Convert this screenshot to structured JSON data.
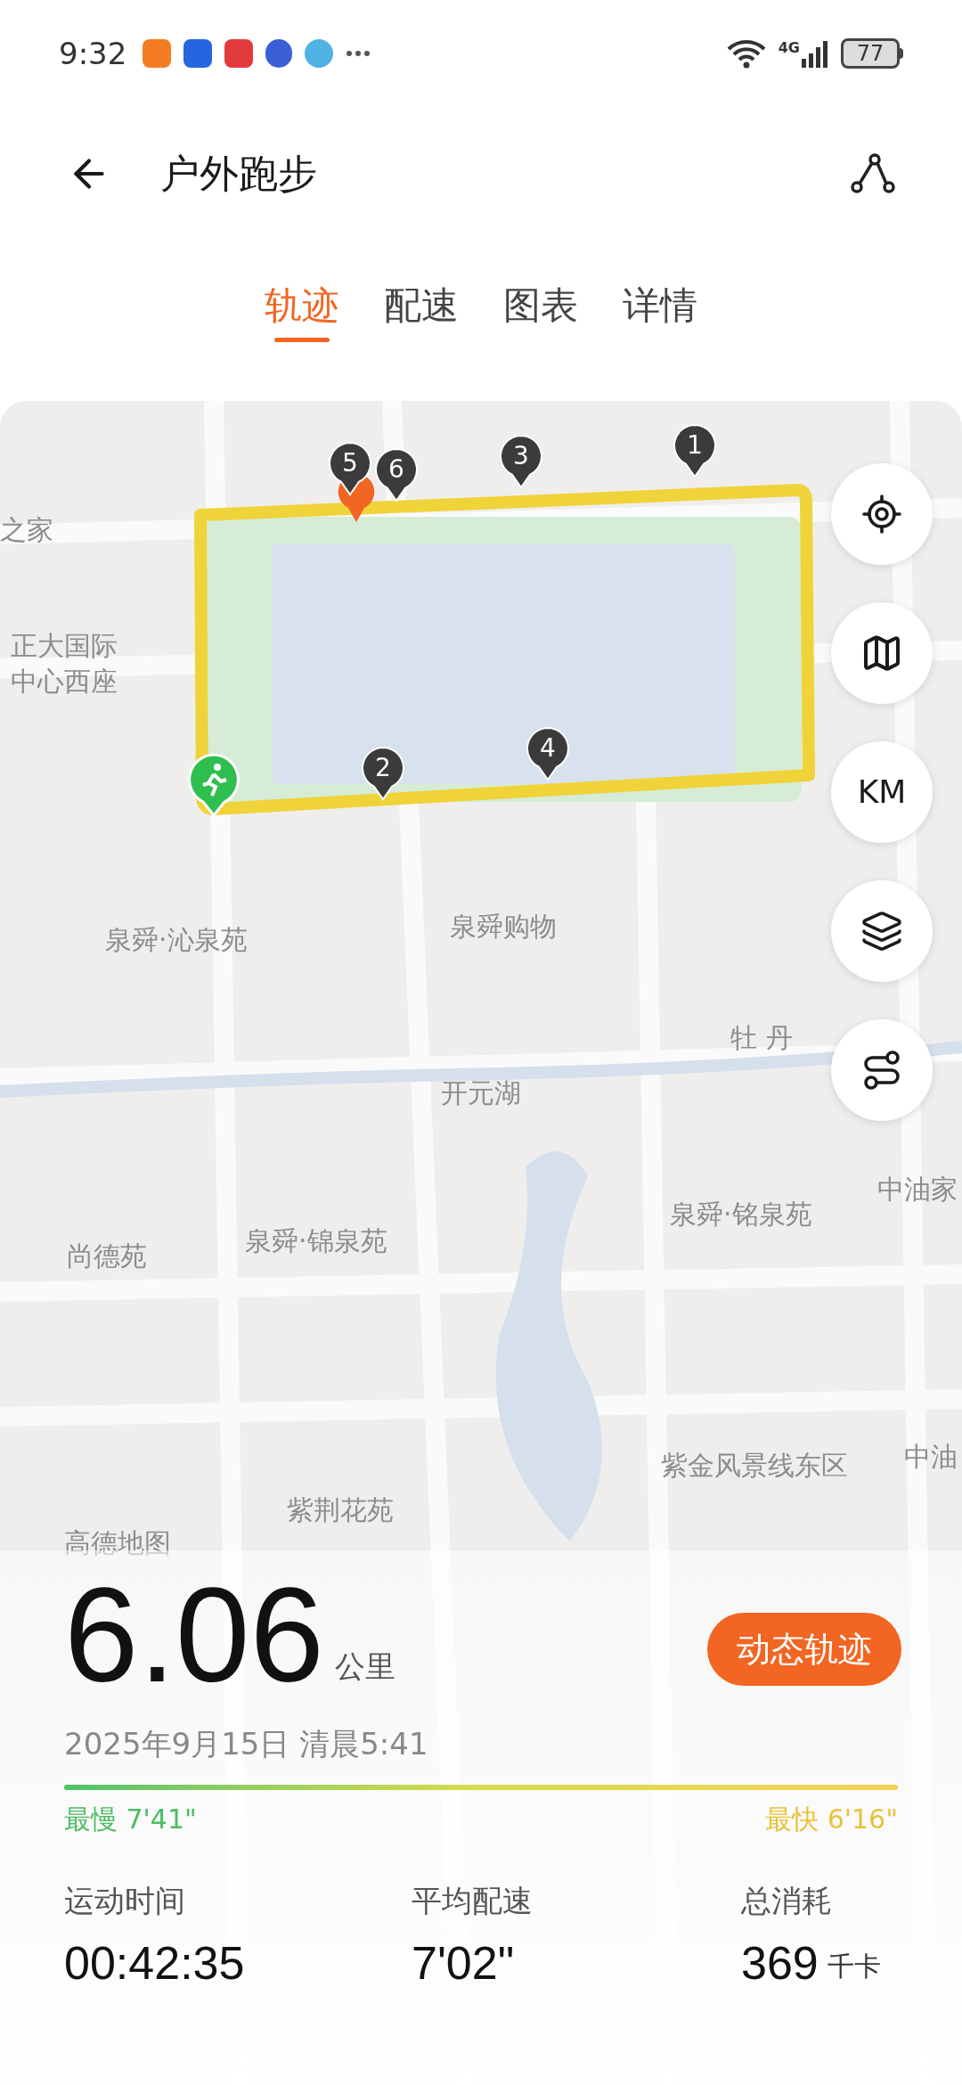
{
  "status_bar": {
    "time": "9:32",
    "network": "4G",
    "battery": "77"
  },
  "header": {
    "title": "户外跑步"
  },
  "tabs": [
    {
      "label": "轨迹",
      "selected": true
    },
    {
      "label": "配速",
      "selected": false
    },
    {
      "label": "图表",
      "selected": false
    },
    {
      "label": "详情",
      "selected": false
    }
  ],
  "map": {
    "labels": [
      "之家",
      "正大国际中心西座",
      "泉舜·沁泉苑",
      "泉舜购物",
      "牡 丹",
      "开元湖",
      "尚德苑",
      "泉舜·锦泉苑",
      "泉舜·铭泉苑",
      "中油家",
      "紫金风景线东区",
      "紫荆花苑",
      "中油",
      "高德地图"
    ],
    "markers": [
      "1",
      "2",
      "3",
      "4",
      "5",
      "6"
    ],
    "controls": [
      {
        "kind": "locate"
      },
      {
        "kind": "map"
      },
      {
        "kind": "text",
        "label": "KM"
      },
      {
        "kind": "layers"
      },
      {
        "kind": "route"
      }
    ]
  },
  "summary": {
    "distance": "6.06",
    "unit": "公里",
    "button": "动态轨迹",
    "date": "2025年9月15日 清晨5:41",
    "slowest": "最慢 7'41\"",
    "fastest": "最快 6'16\""
  },
  "stats": [
    {
      "label": "运动时间",
      "value": "00:42:35"
    },
    {
      "label": "平均配速",
      "value": "7'02\""
    },
    {
      "label": "总消耗",
      "value": "369",
      "unit": "千卡"
    }
  ]
}
